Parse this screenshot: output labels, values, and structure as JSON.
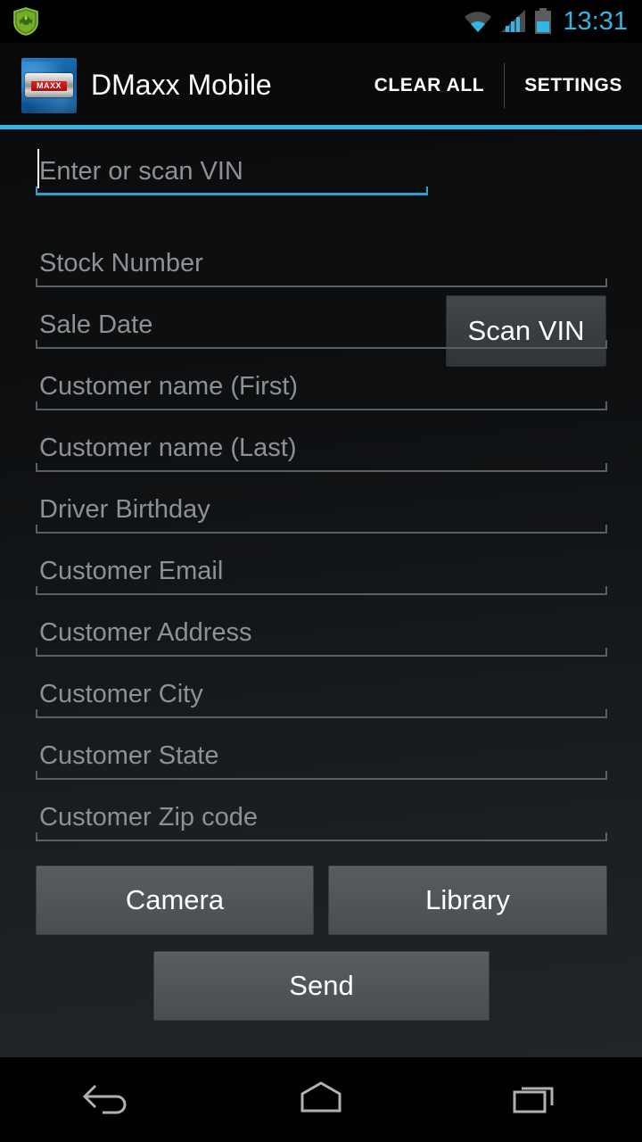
{
  "status_bar": {
    "notification_icon": "shield-icon",
    "wifi_icon": "wifi-icon",
    "signal_icon": "signal-bars-icon",
    "battery_icon": "battery-icon",
    "time": "13:31",
    "accent_color": "#33b5e5"
  },
  "action_bar": {
    "app_icon": "dmaxx-app-icon",
    "app_icon_text": "MAXX",
    "title": "DMaxx Mobile",
    "clear_all_label": "CLEAR ALL",
    "settings_label": "SETTINGS",
    "rule_color": "#33b5e5"
  },
  "form": {
    "vin": {
      "placeholder": "Enter or scan VIN",
      "value": "",
      "focused": true,
      "focus_color": "#33b5e5"
    },
    "scan_button_label": "Scan VIN",
    "fields": [
      {
        "name": "stock-number",
        "placeholder": "Stock Number",
        "value": ""
      },
      {
        "name": "sale-date",
        "placeholder": "Sale Date",
        "value": ""
      },
      {
        "name": "customer-first-name",
        "placeholder": "Customer name (First)",
        "value": ""
      },
      {
        "name": "customer-last-name",
        "placeholder": "Customer name (Last)",
        "value": ""
      },
      {
        "name": "driver-birthday",
        "placeholder": "Driver Birthday",
        "value": ""
      },
      {
        "name": "customer-email",
        "placeholder": "Customer Email",
        "value": ""
      },
      {
        "name": "customer-address",
        "placeholder": "Customer Address",
        "value": ""
      },
      {
        "name": "customer-city",
        "placeholder": "Customer City",
        "value": ""
      },
      {
        "name": "customer-state",
        "placeholder": "Customer State",
        "value": ""
      },
      {
        "name": "customer-zip",
        "placeholder": "Customer Zip code",
        "value": ""
      }
    ],
    "camera_button_label": "Camera",
    "library_button_label": "Library",
    "send_button_label": "Send"
  },
  "nav_bar": {
    "back_icon": "back-arrow-icon",
    "home_icon": "home-icon",
    "recents_icon": "recent-apps-icon"
  }
}
